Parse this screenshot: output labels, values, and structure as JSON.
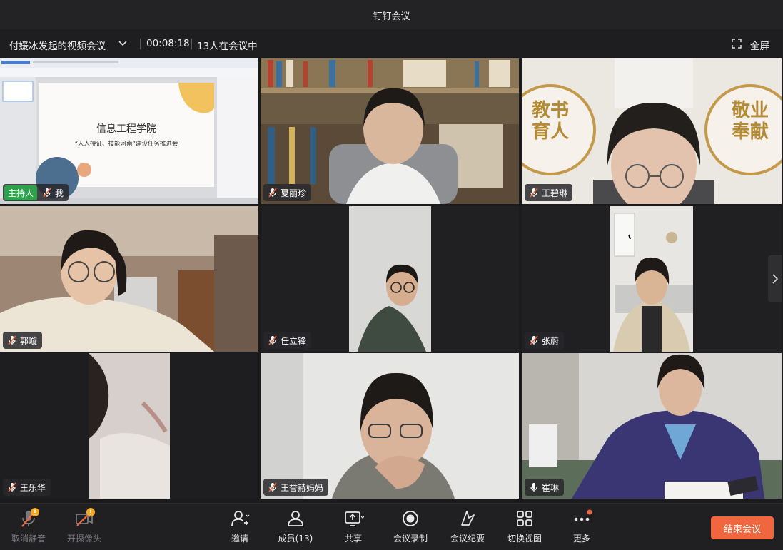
{
  "window": {
    "title": "钉钉会议"
  },
  "header": {
    "meeting_title": "付媛冰发起的视频会议",
    "timer": "00:08:18",
    "participant_count": "13人在会议中",
    "fullscreen_label": "全屏"
  },
  "slide": {
    "title": "信息工程学院",
    "subtitle": "“人人持证、技能河南”建设任务推进会"
  },
  "tiles": [
    {
      "host_badge": "主持人",
      "name": "我",
      "mic": "muted"
    },
    {
      "name": "夏丽珍",
      "mic": "muted"
    },
    {
      "name": "王碧琳",
      "mic": "muted"
    },
    {
      "name": "郭璇",
      "mic": "muted"
    },
    {
      "name": "任立锋",
      "mic": "muted"
    },
    {
      "name": "张蔚",
      "mic": "muted"
    },
    {
      "name": "王乐华",
      "mic": "muted"
    },
    {
      "name": "王誉赫妈妈",
      "mic": "muted"
    },
    {
      "name": "崔琳",
      "mic": "active"
    }
  ],
  "wall_signs": {
    "left": "教书育人",
    "right": "敬业奉献"
  },
  "toolbar": {
    "unmute": "取消静音",
    "camera": "开摄像头",
    "invite": "邀请",
    "members": "成员(13)",
    "share": "共享",
    "record": "会议录制",
    "minutes": "会议纪要",
    "switch_view": "切换视图",
    "more": "更多",
    "end": "结束会议"
  },
  "colors": {
    "accent_end": "#f0663e",
    "host_badge": "#2ea24b",
    "warning_dot": "#f5a623"
  }
}
